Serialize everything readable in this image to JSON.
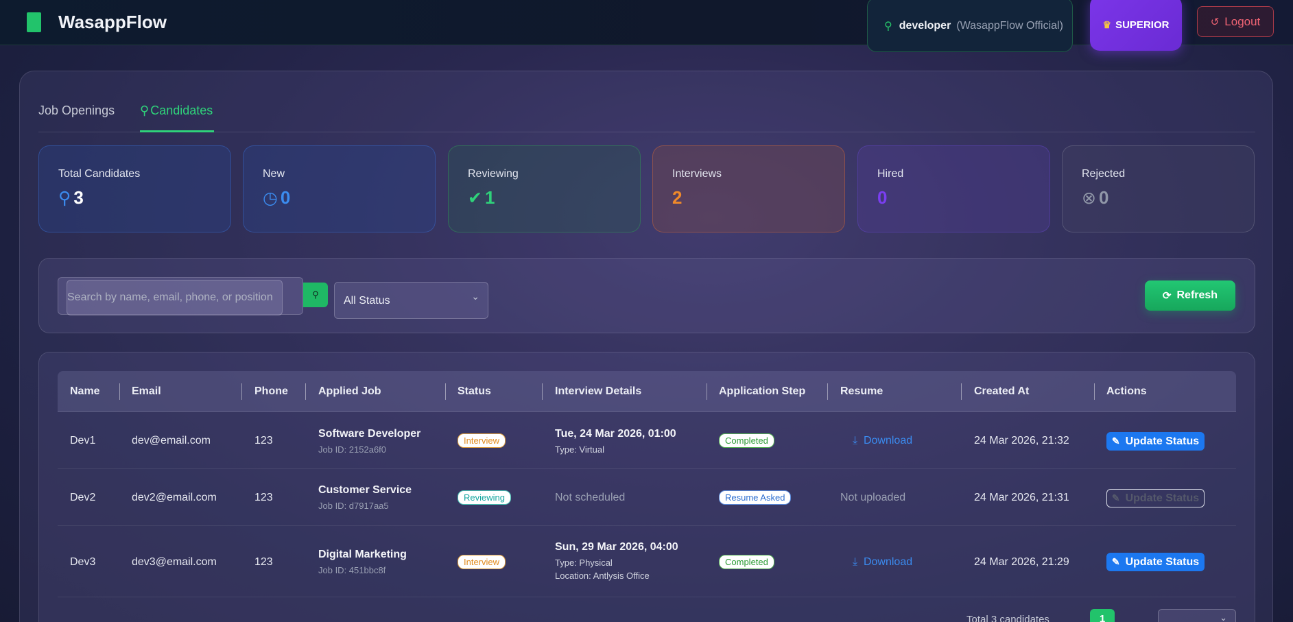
{
  "app": {
    "brand": "WasappFlow",
    "user": {
      "name": "developer",
      "org": "(WasappFlow Official)"
    },
    "plan_label": "SUPERIOR",
    "logout_label": "Logout"
  },
  "tabs": [
    {
      "label": "Job Openings",
      "active": false
    },
    {
      "label": "Candidates",
      "active": true
    }
  ],
  "stats": [
    {
      "label": "Total Candidates",
      "value": "3",
      "icon": "user-icon"
    },
    {
      "label": "New",
      "value": "0",
      "icon": "clock-icon"
    },
    {
      "label": "Reviewing",
      "value": "1",
      "icon": "check-circle-icon"
    },
    {
      "label": "Interviews",
      "value": "2",
      "icon": ""
    },
    {
      "label": "Hired",
      "value": "0",
      "icon": ""
    },
    {
      "label": "Rejected",
      "value": "0",
      "icon": "x-circle-icon"
    }
  ],
  "filters": {
    "search_placeholder": "Search by name, email, phone, or position",
    "status_selected": "All Status",
    "refresh_label": "Refresh"
  },
  "table": {
    "headers": [
      "Name",
      "Email",
      "Phone",
      "Applied Job",
      "Status",
      "Interview Details",
      "Application Step",
      "Resume",
      "Created At",
      "Actions"
    ],
    "rows": [
      {
        "name": "Dev1",
        "email": "dev@email.com",
        "phone": "123",
        "job_title": "Software Developer",
        "job_id": "Job ID: 2152a6f0",
        "status": "Interview",
        "interview_date": "Tue, 24 Mar 2026, 01:00",
        "interview_type": "Type: Virtual",
        "interview_location": "",
        "step": "Completed",
        "resume": "Download",
        "created": "24 Mar 2026, 21:32",
        "action": "Update Status"
      },
      {
        "name": "Dev2",
        "email": "dev2@email.com",
        "phone": "123",
        "job_title": "Customer Service",
        "job_id": "Job ID: d7917aa5",
        "status": "Reviewing",
        "interview_date": "Not scheduled",
        "interview_type": "",
        "interview_location": "",
        "step": "Resume Asked",
        "resume": "Not uploaded",
        "created": "24 Mar 2026, 21:31",
        "action": "Update Status"
      },
      {
        "name": "Dev3",
        "email": "dev3@email.com",
        "phone": "123",
        "job_title": "Digital Marketing",
        "job_id": "Job ID: 451bbc8f",
        "status": "Interview",
        "interview_date": "Sun, 29 Mar 2026, 04:00",
        "interview_type": "Type: Physical",
        "interview_location": "Location: Antlysis Office",
        "step": "Completed",
        "resume": "Download",
        "created": "24 Mar 2026, 21:29",
        "action": "Update Status"
      }
    ]
  },
  "pagination": {
    "total_label": "Total 3 candidates",
    "current_page": "1"
  },
  "colors": {
    "accent_green": "#22c36b",
    "accent_blue": "#1c78f0",
    "accent_purple": "#7b35e8",
    "danger": "#f06474"
  }
}
